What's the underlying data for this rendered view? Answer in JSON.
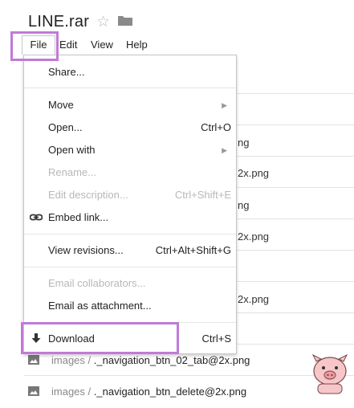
{
  "header": {
    "title": "LINE.rar"
  },
  "menubar": {
    "items": [
      {
        "label": "File"
      },
      {
        "label": "Edit"
      },
      {
        "label": "View"
      },
      {
        "label": "Help"
      }
    ]
  },
  "file_menu": {
    "share": "Share...",
    "move": "Move",
    "open": "Open...",
    "open_sc": "Ctrl+O",
    "open_with": "Open with",
    "rename": "Rename...",
    "edit_desc": "Edit description...",
    "edit_desc_sc": "Ctrl+Shift+E",
    "embed": "Embed link...",
    "view_rev": "View revisions...",
    "view_rev_sc": "Ctrl+Alt+Shift+G",
    "email_collab": "Email collaborators...",
    "email_attach": "Email as attachment...",
    "download": "Download",
    "download_sc": "Ctrl+S"
  },
  "background_files": {
    "partial": [
      "ng",
      "2x.png",
      "ng",
      "2x.png",
      "2x.png"
    ],
    "rows": [
      {
        "folder": "images /",
        "name": "._navigation_btn_02_tab@2x.png"
      },
      {
        "folder": "images /",
        "name": "._navigation_btn_delete@2x.png"
      }
    ]
  }
}
